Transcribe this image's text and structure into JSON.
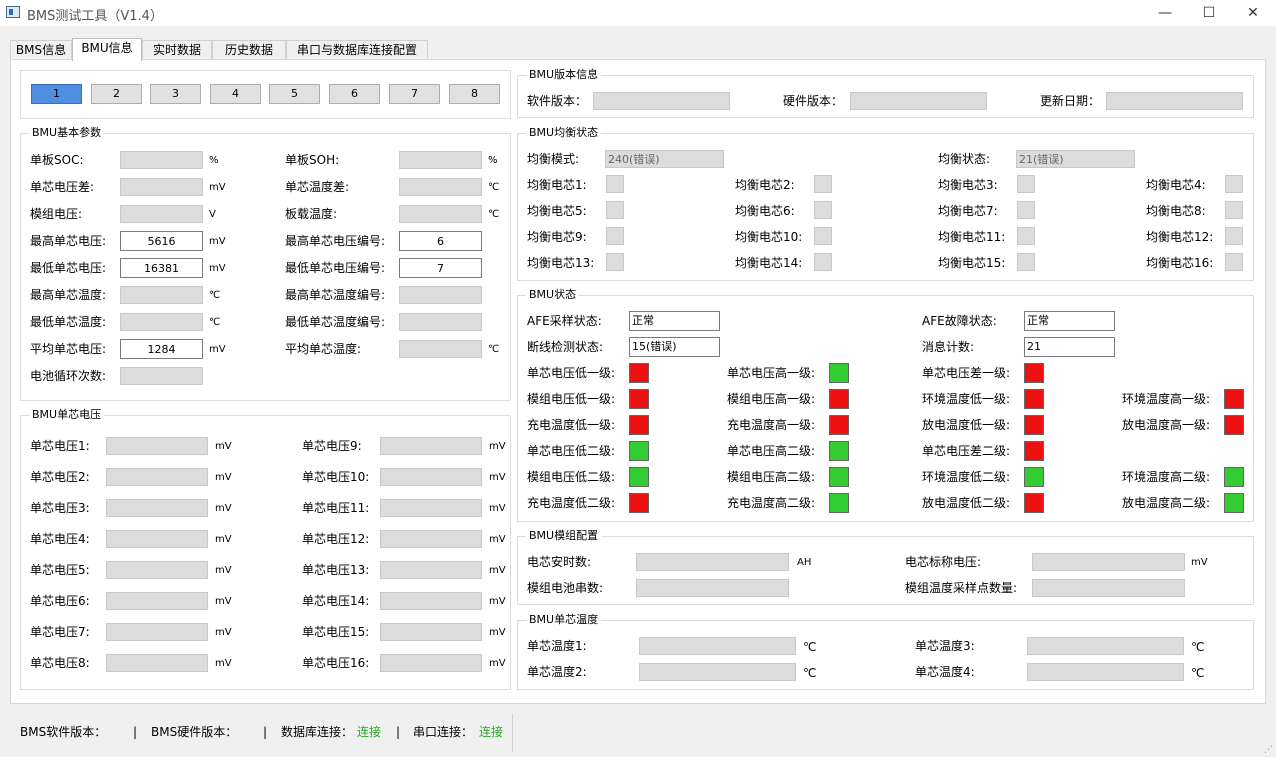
{
  "window": {
    "title": "BMS测试工具（V1.4）"
  },
  "tabs": [
    "BMS信息",
    "BMU信息",
    "实时数据",
    "历史数据",
    "串口与数据库连接配置"
  ],
  "module_buttons": [
    "1",
    "2",
    "3",
    "4",
    "5",
    "6",
    "7",
    "8"
  ],
  "selected_module": "1",
  "version_info": {
    "title": "BMU版本信息",
    "software_label": "软件版本：",
    "hardware_label": "硬件版本：",
    "date_label": "更新日期：",
    "software_value": "",
    "hardware_value": "",
    "date_value": ""
  },
  "basic_params": {
    "title": "BMU基本参数",
    "soc_label": "单板SOC:",
    "soc_value": "",
    "soc_unit": "%",
    "soh_label": "单板SOH:",
    "soh_value": "",
    "soh_unit": "%",
    "vdiff_label": "单芯电压差:",
    "vdiff_value": "",
    "vdiff_unit": "mV",
    "tdiff_label": "单芯温度差:",
    "tdiff_value": "",
    "tdiff_unit": "℃",
    "modv_label": "模组电压:",
    "modv_value": "",
    "modv_unit": "V",
    "boardt_label": "板载温度:",
    "boardt_value": "",
    "boardt_unit": "℃",
    "maxv_label": "最高单芯电压:",
    "maxv_value": "5616",
    "maxv_unit": "mV",
    "maxv_idx_label": "最高单芯电压编号:",
    "maxv_idx_value": "6",
    "minv_label": "最低单芯电压:",
    "minv_value": "16381",
    "minv_unit": "mV",
    "minv_idx_label": "最低单芯电压编号:",
    "minv_idx_value": "7",
    "maxt_label": "最高单芯温度:",
    "maxt_value": "",
    "maxt_unit": "℃",
    "maxt_idx_label": "最高单芯温度编号:",
    "maxt_idx_value": "",
    "mint_label": "最低单芯温度:",
    "mint_value": "",
    "mint_unit": "℃",
    "mint_idx_label": "最低单芯温度编号:",
    "mint_idx_value": "",
    "avgv_label": "平均单芯电压:",
    "avgv_value": "1284",
    "avgv_unit": "mV",
    "avgt_label": "平均单芯温度:",
    "avgt_value": "",
    "avgt_unit": "℃",
    "cycles_label": "电池循环次数:",
    "cycles_value": ""
  },
  "cell_voltage": {
    "title": "BMU单芯电压",
    "unit": "mV",
    "cells": [
      {
        "label": "单芯电压1:",
        "value": ""
      },
      {
        "label": "单芯电压2:",
        "value": ""
      },
      {
        "label": "单芯电压3:",
        "value": ""
      },
      {
        "label": "单芯电压4:",
        "value": ""
      },
      {
        "label": "单芯电压5:",
        "value": ""
      },
      {
        "label": "单芯电压6:",
        "value": ""
      },
      {
        "label": "单芯电压7:",
        "value": ""
      },
      {
        "label": "单芯电压8:",
        "value": ""
      },
      {
        "label": "单芯电压9:",
        "value": ""
      },
      {
        "label": "单芯电压10:",
        "value": ""
      },
      {
        "label": "单芯电压11:",
        "value": ""
      },
      {
        "label": "单芯电压12:",
        "value": ""
      },
      {
        "label": "单芯电压13:",
        "value": ""
      },
      {
        "label": "单芯电压14:",
        "value": ""
      },
      {
        "label": "单芯电压15:",
        "value": ""
      },
      {
        "label": "单芯电压16:",
        "value": ""
      }
    ]
  },
  "balance": {
    "title": "BMU均衡状态",
    "mode_label": "均衡模式:",
    "mode_value": "240(错误)",
    "state_label": "均衡状态:",
    "state_value": "21(错误)",
    "cells": [
      "均衡电芯1:",
      "均衡电芯2:",
      "均衡电芯3:",
      "均衡电芯4:",
      "均衡电芯5:",
      "均衡电芯6:",
      "均衡电芯7:",
      "均衡电芯8:",
      "均衡电芯9:",
      "均衡电芯10:",
      "均衡电芯11:",
      "均衡电芯12:",
      "均衡电芯13:",
      "均衡电芯14:",
      "均衡电芯15:",
      "均衡电芯16:"
    ]
  },
  "bmu_status": {
    "title": "BMU状态",
    "afe_sample_label": "AFE采样状态:",
    "afe_sample_value": "正常",
    "afe_fault_label": "AFE故障状态:",
    "afe_fault_value": "正常",
    "break_label": "断线检测状态:",
    "break_value": "15(错误)",
    "msg_label": "消息计数:",
    "msg_value": "21",
    "indicators": [
      {
        "label": "单芯电压低一级:",
        "state": "red"
      },
      {
        "label": "单芯电压高一级:",
        "state": "green"
      },
      {
        "label": "单芯电压差一级:",
        "state": "red"
      },
      {
        "label": "模组电压低一级:",
        "state": "red"
      },
      {
        "label": "模组电压高一级:",
        "state": "red"
      },
      {
        "label": "环境温度低一级:",
        "state": "red"
      },
      {
        "label": "环境温度高一级:",
        "state": "red"
      },
      {
        "label": "充电温度低一级:",
        "state": "red"
      },
      {
        "label": "充电温度高一级:",
        "state": "red"
      },
      {
        "label": "放电温度低一级:",
        "state": "red"
      },
      {
        "label": "放电温度高一级:",
        "state": "red"
      },
      {
        "label": "单芯电压低二级:",
        "state": "green"
      },
      {
        "label": "单芯电压高二级:",
        "state": "green"
      },
      {
        "label": "单芯电压差二级:",
        "state": "red"
      },
      {
        "label": "模组电压低二级:",
        "state": "green"
      },
      {
        "label": "模组电压高二级:",
        "state": "green"
      },
      {
        "label": "环境温度低二级:",
        "state": "green"
      },
      {
        "label": "环境温度高二级:",
        "state": "green"
      },
      {
        "label": "充电温度低二级:",
        "state": "red"
      },
      {
        "label": "充电温度高二级:",
        "state": "green"
      },
      {
        "label": "放电温度低二级:",
        "state": "red"
      },
      {
        "label": "放电温度高二级:",
        "state": "green"
      }
    ],
    "colors": {
      "red": "#ee1111",
      "green": "#33cc33"
    }
  },
  "module_config": {
    "title": "BMU模组配置",
    "ah_label": "电芯安时数:",
    "ah_unit": "AH",
    "ah_value": "",
    "nominal_label": "电芯标称电压:",
    "nominal_unit": "mV",
    "nominal_value": "",
    "series_label": "模组电池串数:",
    "series_value": "",
    "tsample_label": "模组温度采样点数量:",
    "tsample_value": ""
  },
  "cell_temp": {
    "title": "BMU单芯温度",
    "unit": "℃",
    "cells": [
      {
        "label": "单芯温度1:",
        "value": ""
      },
      {
        "label": "单芯温度2:",
        "value": ""
      },
      {
        "label": "单芯温度3:",
        "value": ""
      },
      {
        "label": "单芯温度4:",
        "value": ""
      }
    ]
  },
  "statusbar": {
    "sw_label": "BMS软件版本：",
    "sw_value": "",
    "hw_label": "BMS硬件版本：",
    "hw_value": "",
    "sep": "|",
    "db_label": "数据库连接：",
    "db_value": "连接",
    "serial_label": "串口连接：",
    "serial_value": "连接"
  }
}
